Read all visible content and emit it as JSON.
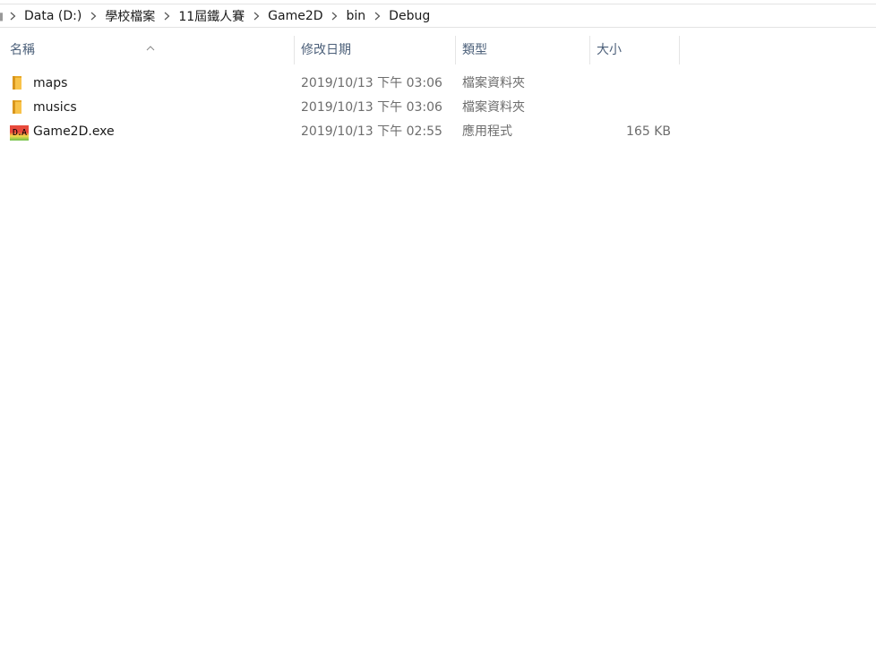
{
  "breadcrumb": {
    "items": [
      "Data (D:)",
      "學校檔案",
      "11屆鐵人賽",
      "Game2D",
      "bin",
      "Debug"
    ]
  },
  "columns": {
    "name": "名稱",
    "date": "修改日期",
    "type": "類型",
    "size": "大小",
    "sort_column": "name",
    "sort_direction": "ascending"
  },
  "files": [
    {
      "name": "maps",
      "date": "2019/10/13 下午 03:06",
      "type": "檔案資料夾",
      "size": "",
      "icon": "folder-icon"
    },
    {
      "name": "musics",
      "date": "2019/10/13 下午 03:06",
      "type": "檔案資料夾",
      "size": "",
      "icon": "folder-icon"
    },
    {
      "name": "Game2D.exe",
      "date": "2019/10/13 下午 02:55",
      "type": "應用程式",
      "size": "165 KB",
      "icon": "exe-icon",
      "icon_text": "D.A"
    }
  ],
  "colors": {
    "folder": "#f8c34a",
    "header_text": "#4c607a",
    "detail_text": "#6d6d6d"
  }
}
